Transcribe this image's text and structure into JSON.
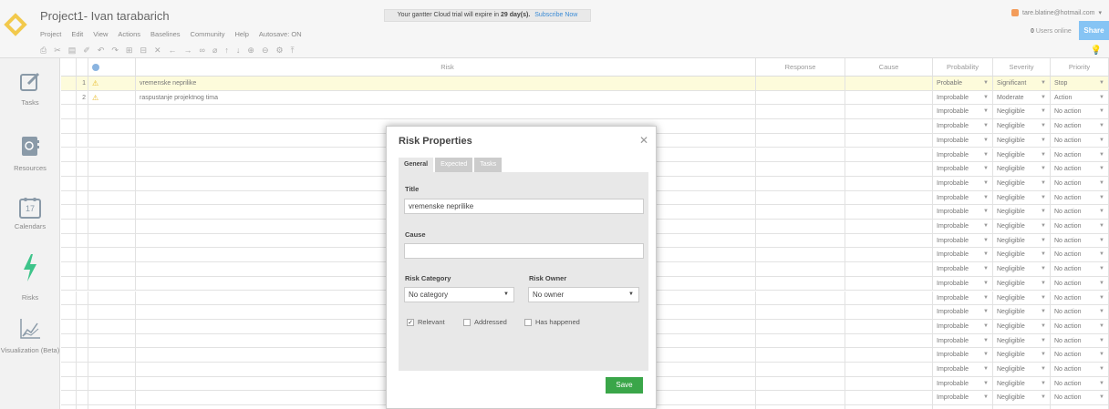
{
  "header": {
    "project_title": "Project1- Ivan tarabarich",
    "menu": [
      "Project",
      "Edit",
      "View",
      "Actions",
      "Baselines",
      "Community",
      "Help",
      "Autosave: ON"
    ],
    "trial_prefix": "Your gantter Cloud trial will expire in",
    "trial_days": "29 day(s).",
    "trial_link": "Subscribe Now",
    "user_email": "tare.blatine@hotmail.com",
    "users_online_count": "0",
    "users_online_label": "Users online",
    "share_label": "Share"
  },
  "sidebar": {
    "items": [
      {
        "label": "Tasks",
        "icon": "edit-icon"
      },
      {
        "label": "Resources",
        "icon": "contact-book-icon"
      },
      {
        "label": "Calendars",
        "icon": "calendar-icon",
        "day": "17"
      },
      {
        "label": "Risks",
        "icon": "lightning-icon"
      },
      {
        "label": "Visualization (Beta)",
        "icon": "chart-icon"
      }
    ]
  },
  "grid": {
    "columns": [
      "",
      "",
      "i",
      "Risk",
      "Response",
      "Cause",
      "Probability",
      "Severity",
      "Priority"
    ],
    "rows": [
      {
        "num": "1",
        "warn": true,
        "risk": "vremenske neprilike",
        "probability": "Probable",
        "severity": "Significant",
        "priority": "Stop"
      },
      {
        "num": "2",
        "warn": true,
        "risk": "raspustanje projektnog tima",
        "probability": "Improbable",
        "severity": "Moderate",
        "priority": "Action"
      }
    ],
    "default_row": {
      "probability": "Improbable",
      "severity": "Negligible",
      "priority": "No action"
    }
  },
  "modal": {
    "title": "Risk Properties",
    "tabs": [
      "General",
      "Expected",
      "Tasks"
    ],
    "title_label": "Title",
    "title_value": "vremenske neprilike",
    "cause_label": "Cause",
    "cause_value": "",
    "category_label": "Risk Category",
    "category_value": "No category",
    "owner_label": "Risk Owner",
    "owner_value": "No owner",
    "checks": [
      {
        "label": "Relevant",
        "checked": true
      },
      {
        "label": "Addressed",
        "checked": false
      },
      {
        "label": "Has happened",
        "checked": false
      }
    ],
    "save_label": "Save"
  }
}
